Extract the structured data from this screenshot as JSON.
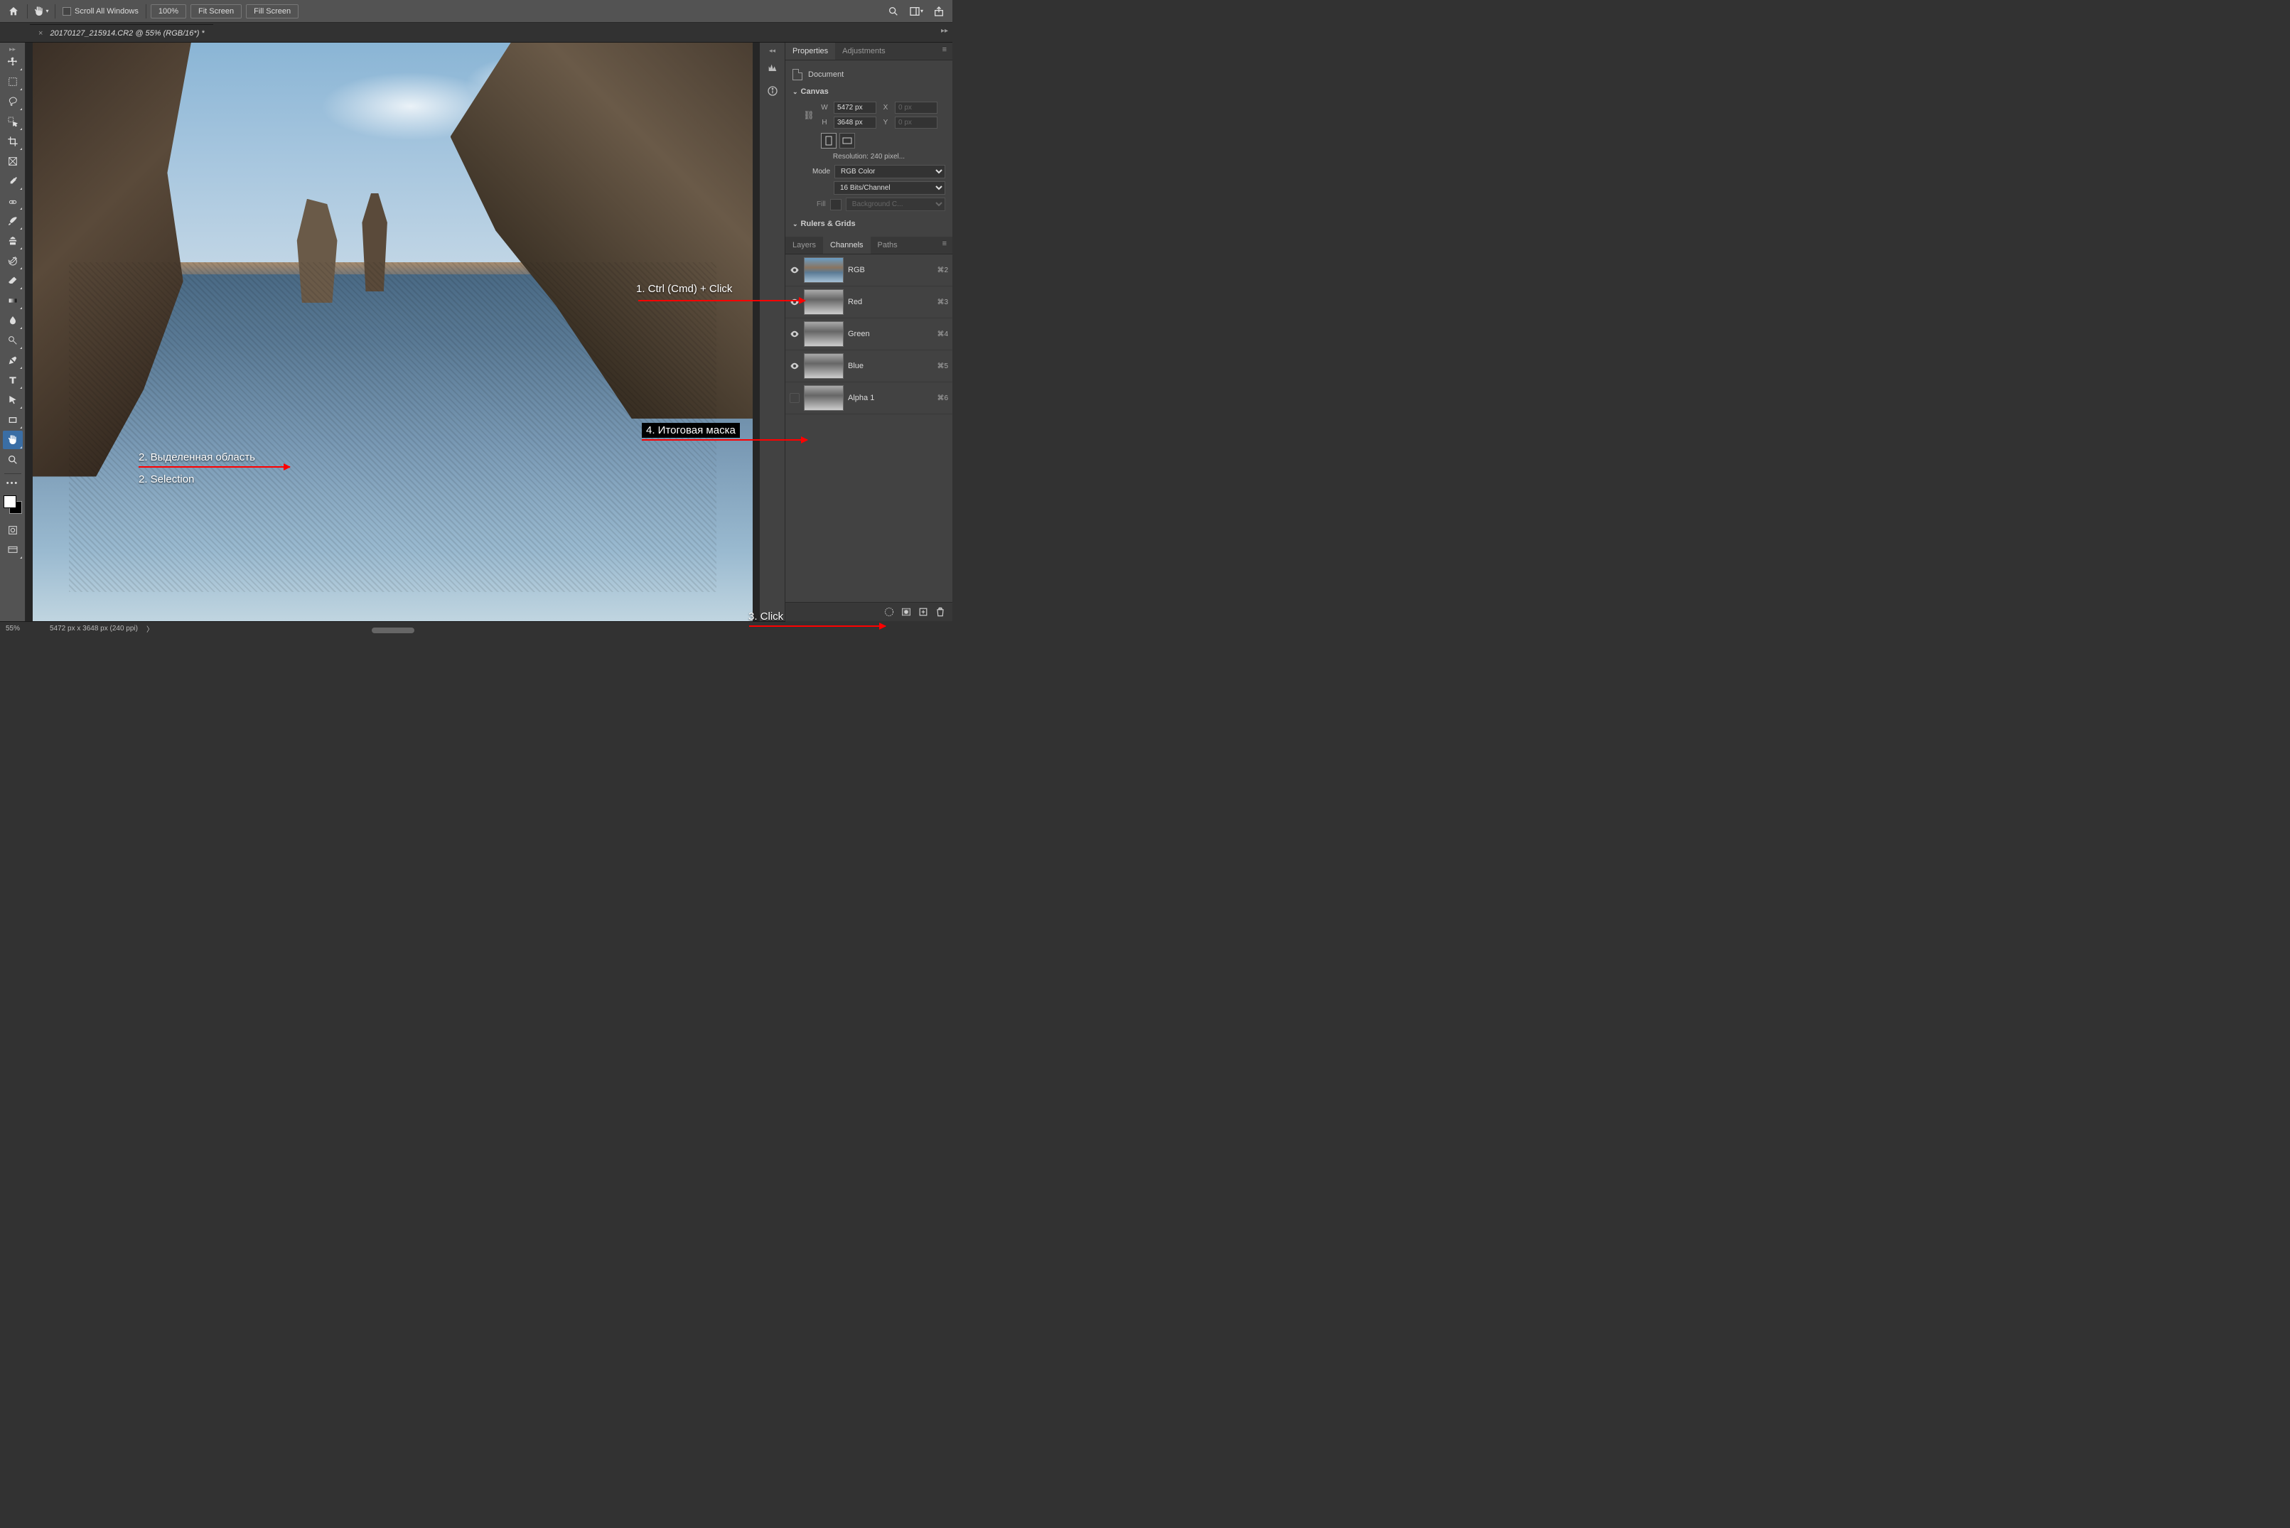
{
  "topbar": {
    "scroll_all_windows": "Scroll All Windows",
    "zoom_value": "100%",
    "fit_screen": "Fit Screen",
    "fill_screen": "Fill Screen"
  },
  "tab": {
    "title": "20170127_215914.CR2 @ 55% (RGB/16*) *"
  },
  "properties": {
    "tab_properties": "Properties",
    "tab_adjustments": "Adjustments",
    "document": "Document",
    "canvas_hdr": "Canvas",
    "w_label": "W",
    "h_label": "H",
    "x_label": "X",
    "y_label": "Y",
    "w_value": "5472 px",
    "h_value": "3648 px",
    "x_value": "0 px",
    "y_value": "0 px",
    "resolution": "Resolution: 240 pixel...",
    "mode_label": "Mode",
    "mode_value": "RGB Color",
    "depth_value": "16 Bits/Channel",
    "fill_label": "Fill",
    "fill_value": "Background C...",
    "rulers_hdr": "Rulers & Grids"
  },
  "channels_panel": {
    "tab_layers": "Layers",
    "tab_channels": "Channels",
    "tab_paths": "Paths",
    "rows": [
      {
        "name": "RGB",
        "key": "⌘2",
        "visible": true,
        "kind": "rgb"
      },
      {
        "name": "Red",
        "key": "⌘3",
        "visible": true,
        "kind": "gray"
      },
      {
        "name": "Green",
        "key": "⌘4",
        "visible": true,
        "kind": "gray"
      },
      {
        "name": "Blue",
        "key": "⌘5",
        "visible": true,
        "kind": "gray"
      },
      {
        "name": "Alpha 1",
        "key": "⌘6",
        "visible": false,
        "kind": "gray"
      }
    ]
  },
  "annotations": {
    "a1": "1. Ctrl (Cmd) + Click",
    "a2a": "2. Выделенная область",
    "a2b": "2. Selection",
    "a3": "3. Click",
    "a4": "4. Итоговая маска"
  },
  "status": {
    "zoom": "55%",
    "dims": "5472 px x 3648 px (240 ppi)",
    "caret": "〉"
  }
}
